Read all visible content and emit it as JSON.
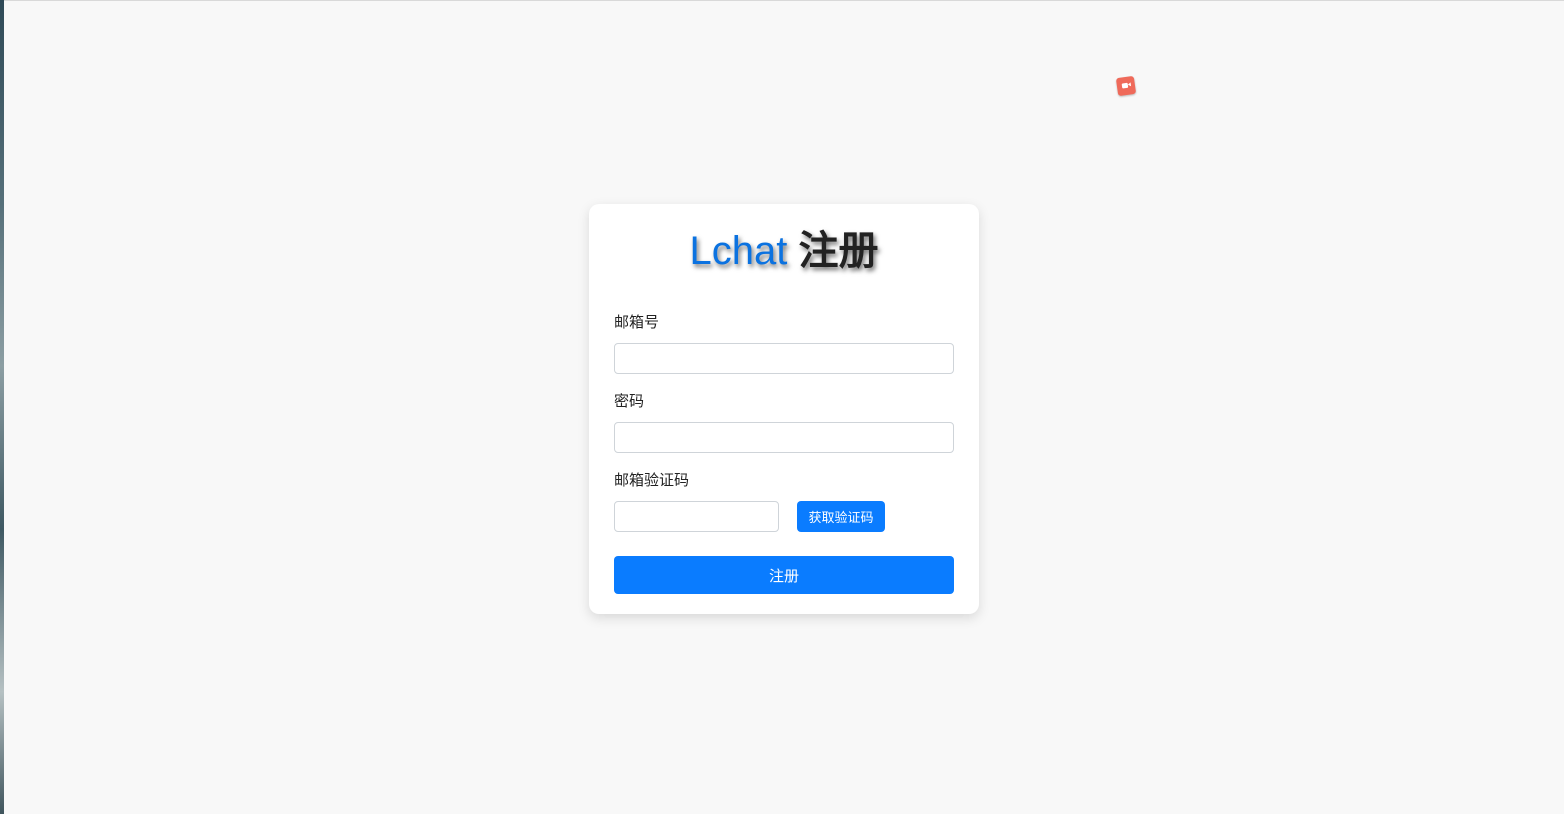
{
  "header": {
    "brand": "Lchat",
    "title": "注册"
  },
  "form": {
    "email_label": "邮箱号",
    "email_value": "",
    "password_label": "密码",
    "password_value": "",
    "code_label": "邮箱验证码",
    "code_value": "",
    "get_code_button": "获取验证码",
    "submit_button": "注册"
  },
  "icons": {
    "recorder": "screen-record-icon"
  },
  "colors": {
    "accent": "#0a7cff",
    "brand": "#0b72e0",
    "background": "#f8f8f8",
    "recorder": "#ef6a5a"
  }
}
